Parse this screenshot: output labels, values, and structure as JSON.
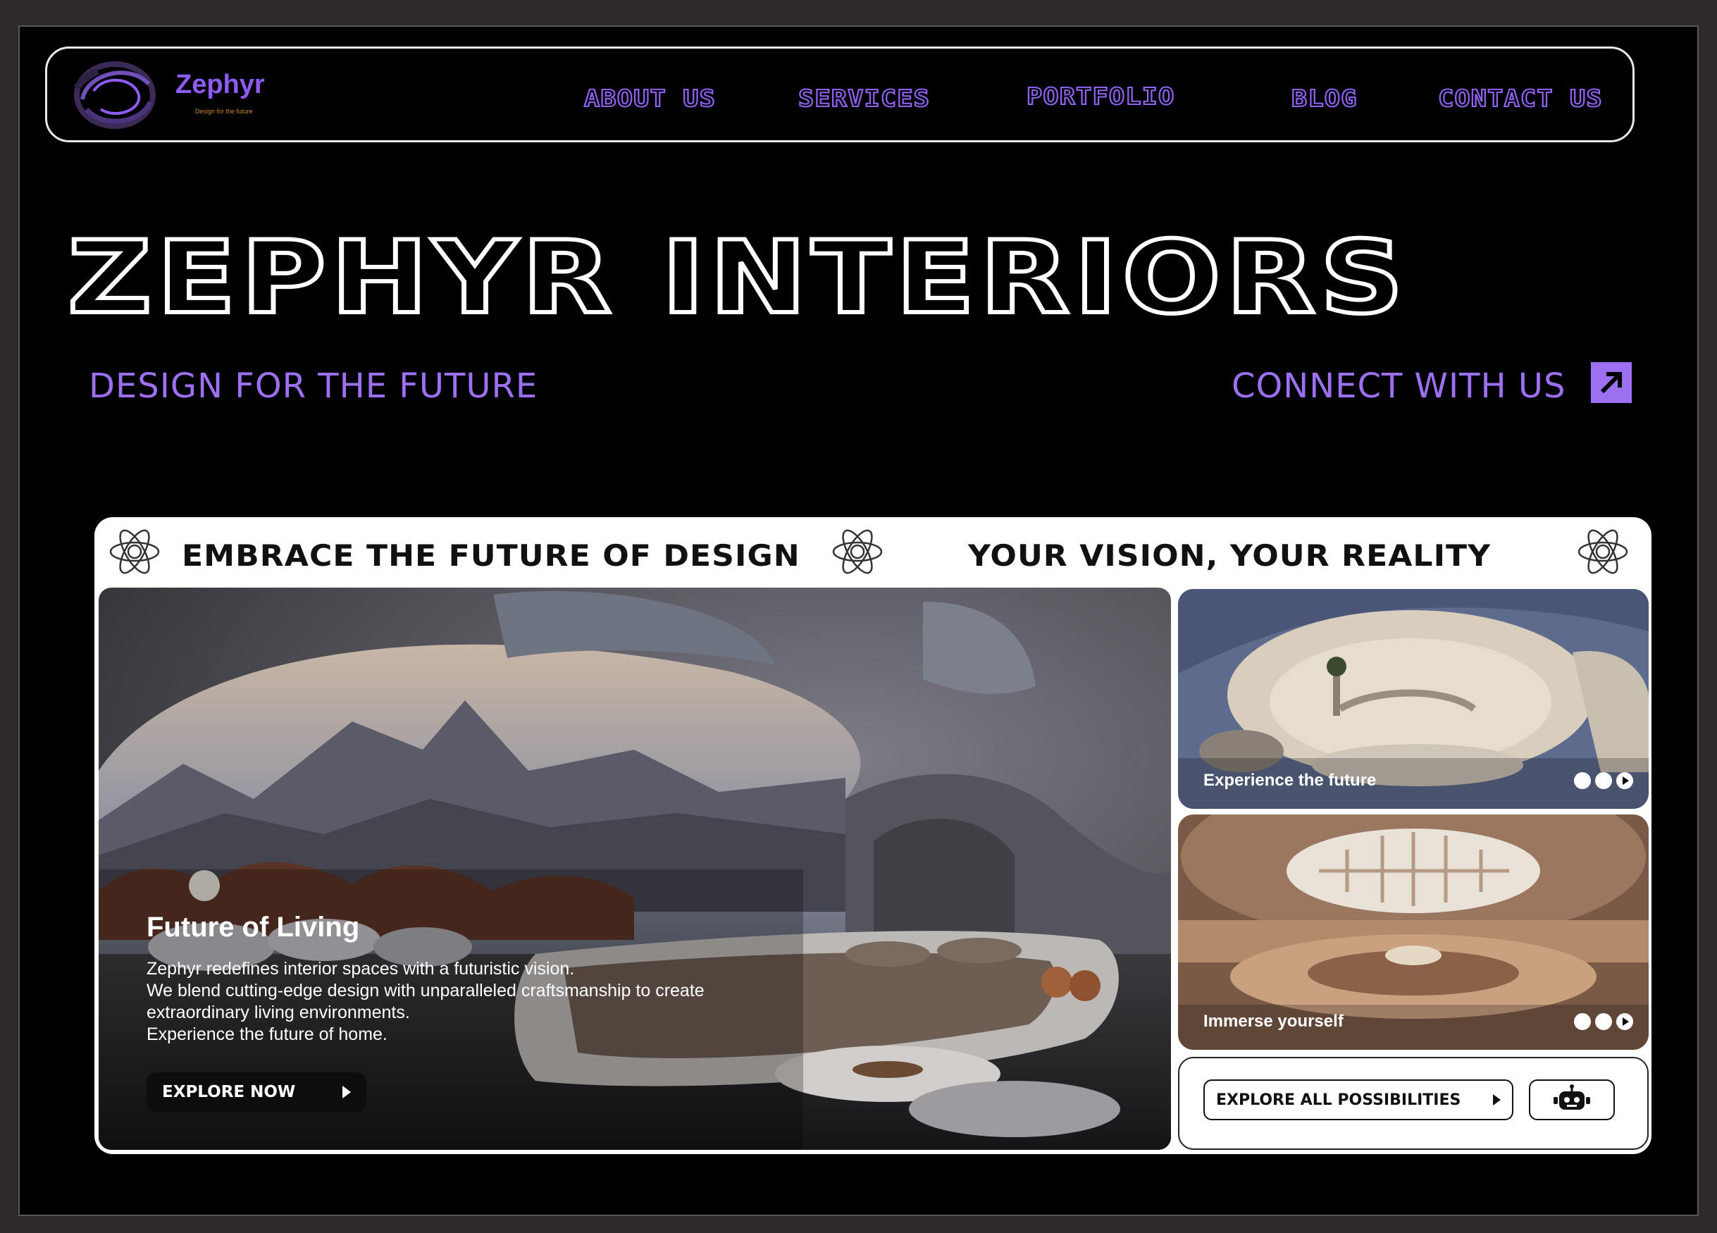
{
  "brand": {
    "name": "Zephyr",
    "tagline": "Design for the future",
    "accent": "#9c70f0"
  },
  "nav": {
    "items": [
      {
        "label": "ABOUT US"
      },
      {
        "label": "SERVICES"
      },
      {
        "label": "PORTFOLIO"
      },
      {
        "label": "BLOG"
      },
      {
        "label": "CONTACT US"
      }
    ]
  },
  "hero": {
    "title": "ZEPHYR INTERIORS",
    "subtitle": "DESIGN FOR THE FUTURE",
    "cta": "CONNECT WITH US",
    "cta_icon": "arrow-up-right-icon"
  },
  "card": {
    "banner_left": "EMBRACE THE FUTURE OF DESIGN",
    "banner_right": "YOUR VISION, YOUR REALITY",
    "banner_icon": "atom-icon",
    "main": {
      "heading": "Future of Living",
      "body": [
        "Zephyr redefines interior spaces with a futuristic vision.",
        "We blend cutting-edge design with unparalleled craftsmanship to create",
        "extraordinary living environments.",
        "Experience the future of home."
      ],
      "button": "EXPLORE NOW"
    },
    "side": [
      {
        "caption": "Experience the future"
      },
      {
        "caption": "Immerse yourself"
      }
    ],
    "explore_all": "EXPLORE ALL POSSIBILITIES",
    "bot_icon": "robot-icon"
  }
}
